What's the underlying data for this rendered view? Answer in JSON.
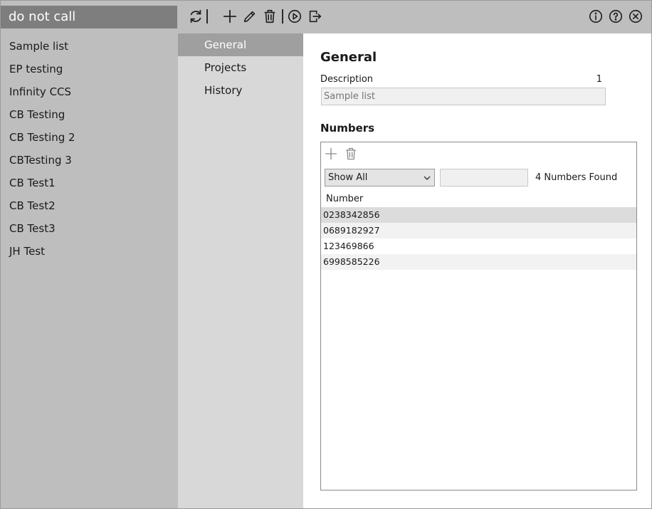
{
  "left_panel": {
    "header": "do not call",
    "items": [
      "Sample list",
      "EP testing",
      "Infinity CCS",
      "CB Testing",
      "CB Testing 2",
      "CBTesting 3",
      "CB Test1",
      "CB Test2",
      "CB Test3",
      "JH Test"
    ]
  },
  "toolbar": {
    "icons": [
      "refresh-icon",
      "add-icon",
      "edit-icon",
      "delete-icon",
      "play-icon",
      "exit-icon",
      "info-icon",
      "help-icon",
      "close-icon"
    ]
  },
  "nav": {
    "items": [
      "General",
      "Projects",
      "History"
    ],
    "active": "General"
  },
  "general": {
    "title": "General",
    "description_label": "Description",
    "description_count": "1",
    "description_placeholder": "Sample list"
  },
  "numbers": {
    "title": "Numbers",
    "filter_selected": "Show All",
    "found_text": "4 Numbers Found",
    "column_header": "Number",
    "rows": [
      "0238342856",
      "0689182927",
      "123469866",
      "6998585226"
    ]
  },
  "colors": {
    "panel_gray": "#bebebe",
    "header_dark": "#7e7e7e",
    "nav_bg": "#d8d8d8",
    "nav_active": "#9f9f9f"
  }
}
